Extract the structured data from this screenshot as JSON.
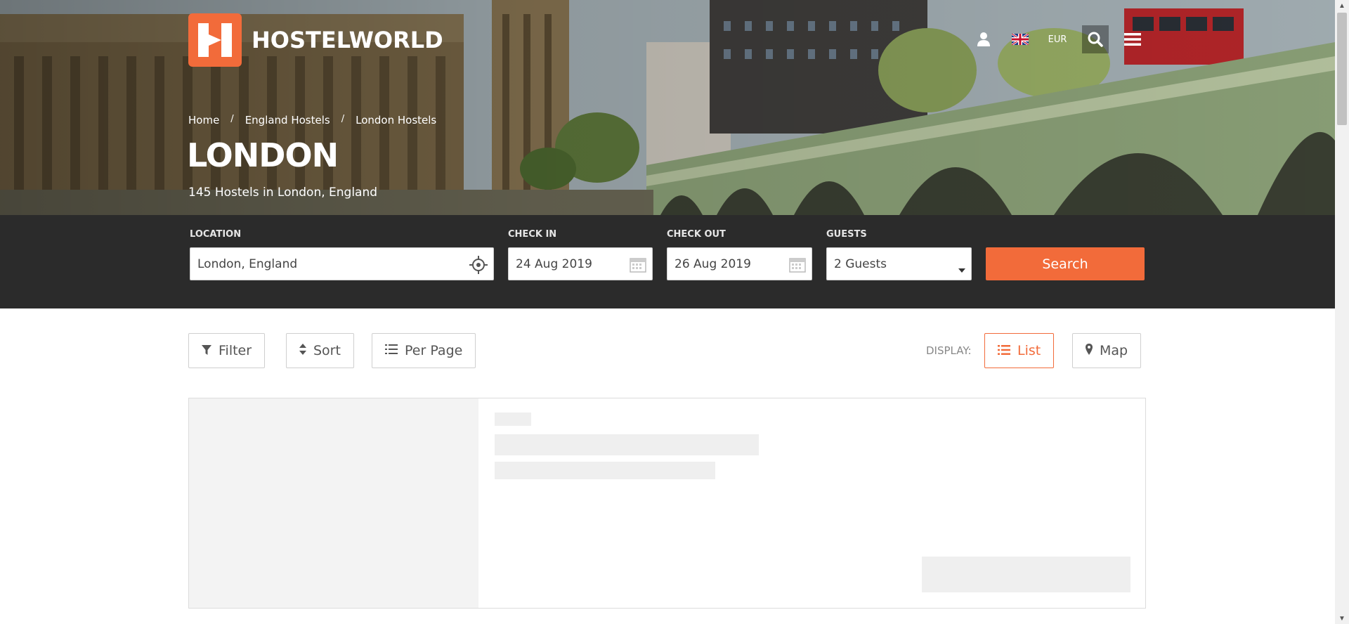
{
  "brand": {
    "name": "HOSTELWORLD",
    "accent": "#f26b3a"
  },
  "header": {
    "currency": "EUR",
    "icons": [
      "user-icon",
      "uk-flag-icon",
      "search-icon",
      "menu-icon"
    ]
  },
  "breadcrumb": [
    {
      "label": "Home"
    },
    {
      "label": "England Hostels"
    },
    {
      "label": "London Hostels"
    }
  ],
  "breadcrumb_separator": "/",
  "hero": {
    "title": "LONDON",
    "subtitle": "145 Hostels in London, England"
  },
  "search": {
    "location": {
      "label": "LOCATION",
      "value": "London, England"
    },
    "check_in": {
      "label": "CHECK IN",
      "value": "24 Aug 2019"
    },
    "check_out": {
      "label": "CHECK OUT",
      "value": "26 Aug 2019"
    },
    "guests": {
      "label": "GUESTS",
      "value": "2 Guests"
    },
    "submit_label": "Search"
  },
  "toolbar": {
    "filter_label": "Filter",
    "sort_label": "Sort",
    "per_page_label": "Per Page",
    "display_label": "DISPLAY:",
    "list_label": "List",
    "map_label": "Map",
    "active_view": "List"
  }
}
